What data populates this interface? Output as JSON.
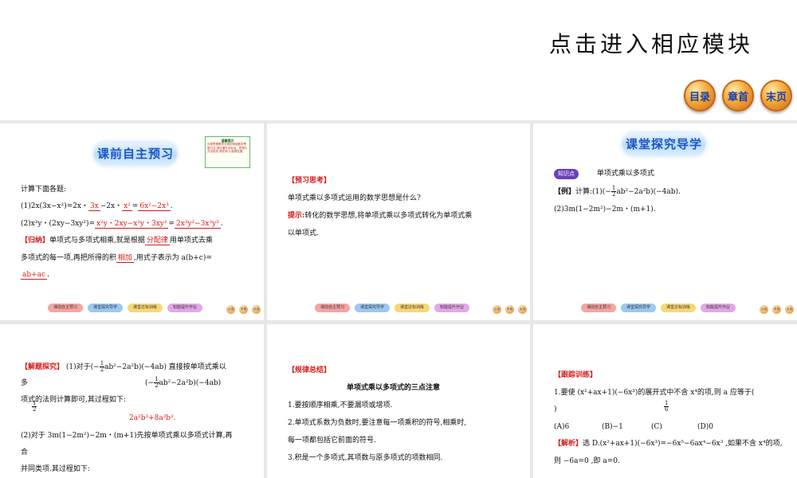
{
  "header": {
    "title": "点击进入相应模块",
    "nav": [
      "目录",
      "章首",
      "末页"
    ]
  },
  "footer_tabs": [
    "课前自主预习",
    "课堂探究导学",
    "课堂达标训练",
    "知能提升作业"
  ],
  "footer_mini": [
    "目录",
    "章首",
    "末页"
  ],
  "slide1": {
    "banner": "课前自主预习",
    "note_title": "温馨提示",
    "note_text": "分类思想数学分类的常用数学思想方法,请在课件中标出。思想与方法探究,请在练习,能够发展。",
    "intro": "计算下面各题:",
    "l1_pre": "(1)2x(3x−x²)=2x・",
    "l1_a1": "3x",
    "l1_mid": "−2x・",
    "l1_a2": "x²",
    "l1_eq": "=",
    "l1_a3": "6x²−2x³",
    "l1_end": ".",
    "l2_pre": "(2)x²y・(2xy−3xy²)=",
    "l2_a1": "x²y・2xy−x²y・3xy²",
    "l2_eq": "=",
    "l2_a2": "2x³y²−3x³y³",
    "l2_end": ".",
    "guina_tag": "【归纳】",
    "l3_pre": "单项式与多项式相乘,就是根据",
    "l3_a1": "分配律",
    "l3_post": "用单项式去乘",
    "l4_pre": "多项式的每一项,再把所得的积",
    "l4_a1": "相加",
    "l4_post": ",用式子表示为 a(b+c)=",
    "l5_a1": "ab+ac",
    "l5_end": "."
  },
  "slide2": {
    "tag": "【预习思考】",
    "question": "单项式乘以多项式运用的数学思想是什么?",
    "hint_tag": "提示:",
    "hint_1": "转化的数学思想,将单项式乘以多项式转化为单项式乘",
    "hint_2": "以单项式."
  },
  "slide3": {
    "banner": "课堂探究导学",
    "kd_label": "知识点",
    "kd_title": "单项式乘以多项式",
    "ex_tag": "【例】",
    "ex_pre": "计算:(1)(−",
    "ex_frac_n": "1",
    "ex_frac_d": "2",
    "ex_post": "ab²−2a²b)(−4ab).",
    "ex_2": "(2)3m(1−2m²)−2m・(m+1)."
  },
  "slide4": {
    "tag": "【解题探究】",
    "l1_pre": "(1)对于(−",
    "l1_frac_n": "1",
    "l1_frac_d": "2",
    "l1_post": "ab²−2a²b)(−4ab) 直接按单项式乘以",
    "l2": "多",
    "l2b_pre": "(−",
    "l2b_frac_n": "1",
    "l2b_frac_d": "2",
    "l2b_post": "ab²−2a²b)(−4ab)",
    "l3": "项式的法则计算即可,其过程如下:",
    "l4_frac_n": "1",
    "l4_frac_d": "2",
    "answer": "2a²b³+8a³b².",
    "l5": "(2)对于 3m(1−2m²)−2m・(m+1)先按单项式乘以多项式计算,再",
    "l6": "合",
    "l7": "并同类项.其过程如下:"
  },
  "slide5": {
    "tag": "【规律总结】",
    "title": "单项式乘以多项式的三点注意",
    "r1": "1.要按顺序相乘,不要漏项或增项.",
    "r2": "2.单项式系数为负数时,要注意每一项乘积的符号,相乘时,",
    "r2b": "每一项都包括它前面的符号.",
    "r3": "3.积是一个多项式,其项数与原多项式的项数相同."
  },
  "slide6": {
    "tag": "【跟踪训练】",
    "q1": "1.要使 (x²+ax+1)(−6x³)的展开式中不含 x⁴的项,则 a 应等于(",
    "q1b": ")",
    "opt_a": "(A)6",
    "opt_b": "(B)−1",
    "opt_c_frac_n": "1",
    "opt_c_frac_d": "6",
    "opt_c": "(C)",
    "opt_d": "(D)0",
    "jx_tag": "【解析】",
    "jx_1": "选 D.(x²+ax+1)(−6x³)=−6x⁵−6ax⁴−6x³ ,如果不含 x⁴的项,",
    "jx_2": "则 −6a=0 ,即 a=0."
  }
}
